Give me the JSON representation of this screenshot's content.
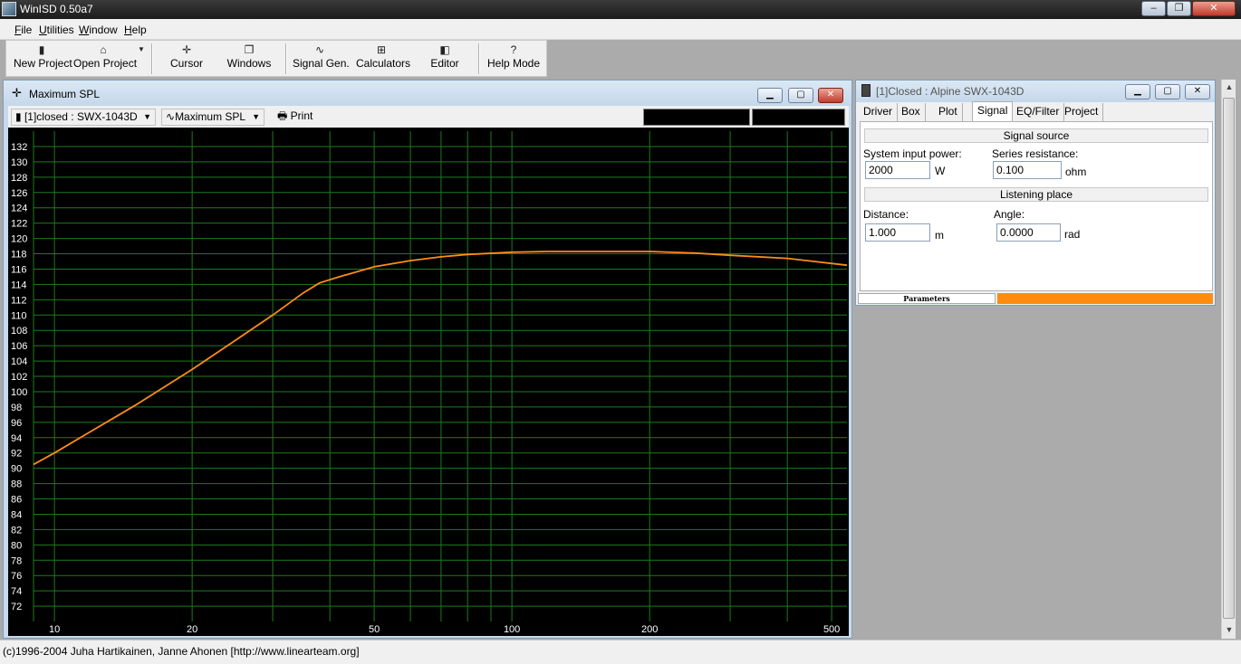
{
  "app": {
    "title": "WinISD 0.50a7",
    "window_controls": {
      "minimize": "–",
      "restore": "❐",
      "close": "✕"
    }
  },
  "menu": [
    {
      "label": "File",
      "accel": "F",
      "rest": "ile"
    },
    {
      "label": "Utilities",
      "accel": "U",
      "rest": "tilities"
    },
    {
      "label": "Window",
      "accel": "W",
      "rest": "indow"
    },
    {
      "label": "Help",
      "accel": "H",
      "rest": "elp"
    }
  ],
  "toolbar": {
    "new_project": "New Project",
    "open_project": "Open Project",
    "cursor": "Cursor",
    "windows": "Windows",
    "signal_gen": "Signal Gen.",
    "calculators": "Calculators",
    "editor": "Editor",
    "help_mode": "Help Mode",
    "help_mode_icon": "?"
  },
  "chart_window": {
    "title": "Maximum SPL",
    "project_combo": "[1]closed : SWX-1043D",
    "plot_combo": "Maximum SPL",
    "print_label": "Print"
  },
  "chart_data": {
    "type": "line",
    "title": "",
    "xlabel": "",
    "ylabel": "",
    "x_scale": "log",
    "xlim": [
      9,
      540
    ],
    "ylim": [
      70,
      134
    ],
    "grid": true,
    "background": "#000000",
    "grid_color": "#1f7a1f",
    "line_color": "#ff8c1a",
    "text_color": "#ffffff",
    "x_ticks": [
      10,
      20,
      50,
      100,
      200,
      500
    ],
    "x_gridlines": [
      10,
      20,
      30,
      40,
      50,
      60,
      70,
      80,
      90,
      100,
      200,
      300,
      400,
      500
    ],
    "y_ticks": [
      72,
      74,
      76,
      78,
      80,
      82,
      84,
      86,
      88,
      90,
      92,
      94,
      96,
      98,
      100,
      102,
      104,
      106,
      108,
      110,
      112,
      114,
      116,
      118,
      120,
      122,
      124,
      126,
      128,
      130,
      132
    ],
    "series": [
      {
        "x": [
          9,
          10,
          12,
          15,
          20,
          25,
          30,
          35,
          38,
          42,
          50,
          60,
          70,
          80,
          100,
          120,
          150,
          200,
          250,
          300,
          400,
          540
        ],
        "y": [
          90.5,
          92.0,
          94.8,
          98.2,
          102.9,
          106.8,
          110.0,
          112.9,
          114.2,
          115.0,
          116.3,
          117.1,
          117.6,
          117.9,
          118.2,
          118.3,
          118.3,
          118.3,
          118.1,
          117.8,
          117.4,
          116.5
        ]
      }
    ]
  },
  "props_window": {
    "title": "[1]Closed : Alpine SWX-1043D",
    "tabs": [
      "Driver",
      "Box",
      "Plot",
      "Signal",
      "EQ/Filter",
      "Project"
    ],
    "active_tab": "Signal",
    "signal_source": {
      "header": "Signal source",
      "power_label": "System input power:",
      "power_value": "2000",
      "power_unit": "W",
      "resistance_label": "Series resistance:",
      "resistance_value": "0.100",
      "resistance_unit": "ohm"
    },
    "listening_place": {
      "header": "Listening place",
      "distance_label": "Distance:",
      "distance_value": "1.000",
      "distance_unit": "m",
      "angle_label": "Angle:",
      "angle_value": "0.0000",
      "angle_unit": "rad"
    },
    "status_label": "Parameters"
  },
  "statusbar": {
    "text": "(c)1996-2004 Juha Hartikainen, Janne Ahonen [http://www.linearteam.org]"
  }
}
